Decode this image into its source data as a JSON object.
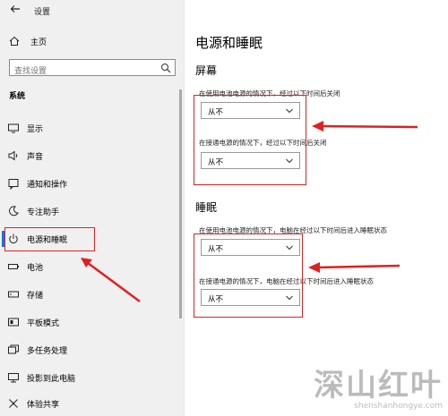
{
  "window": {
    "title": "设置"
  },
  "sidebar": {
    "home_label": "主页",
    "search_placeholder": "查找设置",
    "section_label": "系统",
    "items": [
      {
        "label": "显示",
        "icon": "monitor-icon"
      },
      {
        "label": "声音",
        "icon": "speaker-icon"
      },
      {
        "label": "通知和操作",
        "icon": "notification-icon"
      },
      {
        "label": "专注助手",
        "icon": "moon-icon"
      },
      {
        "label": "电源和睡眠",
        "icon": "power-icon",
        "active": true
      },
      {
        "label": "电池",
        "icon": "battery-icon"
      },
      {
        "label": "存储",
        "icon": "storage-icon"
      },
      {
        "label": "平板模式",
        "icon": "tablet-mode-icon"
      },
      {
        "label": "多任务处理",
        "icon": "multitasking-icon"
      },
      {
        "label": "投影到此电脑",
        "icon": "project-icon"
      },
      {
        "label": "体验共享",
        "icon": "shared-experiences-icon"
      }
    ]
  },
  "main": {
    "title": "电源和睡眠",
    "screen": {
      "heading": "屏幕",
      "battery_desc": "在使用电池电源的情况下，经过以下时间后关闭",
      "battery_value": "从不",
      "plugged_desc": "在接通电源的情况下，经过以下时间后关闭",
      "plugged_value": "从不"
    },
    "sleep": {
      "heading": "睡眠",
      "battery_desc": "在使用电池电源的情况下，电脑在经过以下时间后进入睡眠状态",
      "battery_value": "从不",
      "plugged_desc": "在接通电源的情况下，电脑在经过以下时间后进入睡眠状态",
      "plugged_value": "从不"
    }
  },
  "watermark": {
    "text": "深山红叶",
    "url": "shenshanhongye.com"
  },
  "colors": {
    "accent": "#0078d7",
    "annotation": "#e02020"
  }
}
